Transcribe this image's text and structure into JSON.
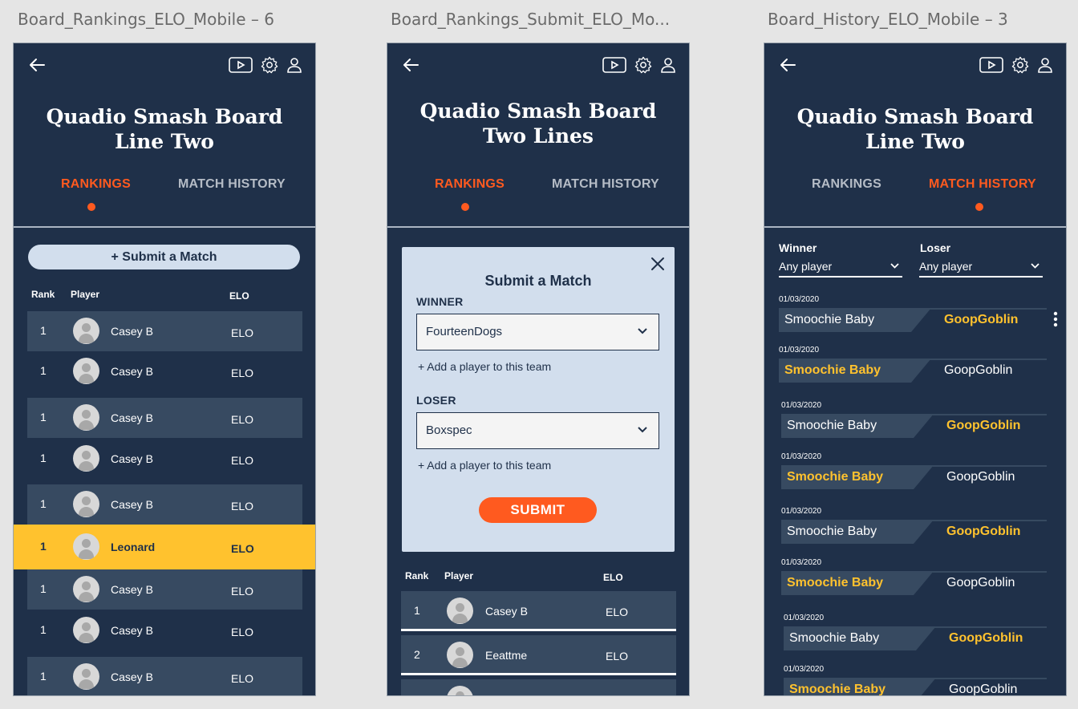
{
  "frames": {
    "rankings": {
      "label": "Board_Rankings_ELO_Mobile – 6",
      "title_line1": "Quadio Smash Board",
      "title_line2": "Line Two",
      "tab_rankings": "RANKINGS",
      "tab_history": "MATCH HISTORY",
      "submit_label": "+ Submit a Match",
      "col_rank": "Rank",
      "col_player": "Player",
      "col_elo": "ELO",
      "rows": [
        {
          "rank": "1",
          "name": "Casey B",
          "elo": "ELO"
        },
        {
          "rank": "1",
          "name": "Casey B",
          "elo": "ELO"
        },
        {
          "rank": "1",
          "name": "Casey B",
          "elo": "ELO"
        },
        {
          "rank": "1",
          "name": "Casey B",
          "elo": "ELO"
        },
        {
          "rank": "1",
          "name": "Casey B",
          "elo": "ELO"
        },
        {
          "rank": "1",
          "name": "Leonard",
          "elo": "ELO"
        },
        {
          "rank": "1",
          "name": "Casey B",
          "elo": "ELO"
        },
        {
          "rank": "1",
          "name": "Casey B",
          "elo": "ELO"
        },
        {
          "rank": "1",
          "name": "Casey B",
          "elo": "ELO"
        }
      ]
    },
    "submit": {
      "label": "Board_Rankings_Submit_ELO_Mo...",
      "title_line1": "Quadio Smash Board",
      "title_line2": "Two Lines",
      "tab_rankings": "RANKINGS",
      "tab_history": "MATCH HISTORY",
      "modal_title": "Submit a Match",
      "winner_label": "WINNER",
      "winner_value": "FourteenDogs",
      "add_player": "+ Add a player to this team",
      "loser_label": "LOSER",
      "loser_value": "Boxspec",
      "submit_button": "SUBMIT",
      "col_rank": "Rank",
      "col_player": "Player",
      "col_elo": "ELO",
      "rows": [
        {
          "rank": "1",
          "name": "Casey B",
          "elo": "ELO"
        },
        {
          "rank": "2",
          "name": "Eeattme",
          "elo": "ELO"
        }
      ]
    },
    "history": {
      "label": "Board_History_ELO_Mobile – 3",
      "title_line1": "Quadio Smash Board",
      "title_line2": "Line Two",
      "tab_rankings": "RANKINGS",
      "tab_history": "MATCH HISTORY",
      "winner_label": "Winner",
      "loser_label": "Loser",
      "winner_filter": "Any player",
      "loser_filter": "Any player",
      "matches": [
        {
          "date": "01/03/2020",
          "player1": "Smoochie Baby",
          "player2": "GoopGoblin",
          "winner": 2
        },
        {
          "date": "01/03/2020",
          "player1": "Smoochie Baby",
          "player2": "GoopGoblin",
          "winner": 1
        },
        {
          "date": "01/03/2020",
          "player1": "Smoochie Baby",
          "player2": "GoopGoblin",
          "winner": 2
        },
        {
          "date": "01/03/2020",
          "player1": "Smoochie Baby",
          "player2": "GoopGoblin",
          "winner": 1
        },
        {
          "date": "01/03/2020",
          "player1": "Smoochie Baby",
          "player2": "GoopGoblin",
          "winner": 2
        },
        {
          "date": "01/03/2020",
          "player1": "Smoochie Baby",
          "player2": "GoopGoblin",
          "winner": 1
        },
        {
          "date": "01/03/2020",
          "player1": "Smoochie Baby",
          "player2": "GoopGoblin",
          "winner": 2
        },
        {
          "date": "01/03/2020",
          "player1": "Smoochie Baby",
          "player2": "GoopGoblin",
          "winner": 1
        }
      ]
    }
  },
  "colors": {
    "background": "#1f3049",
    "accent": "#ff5a1f",
    "highlight": "#ffc22e",
    "row_alt": "#374a61",
    "panel": "#d2deed"
  },
  "icons": [
    "back-arrow-icon",
    "video-play-icon",
    "gear-icon",
    "user-icon",
    "close-icon",
    "chevron-down-icon",
    "kebab-menu-icon",
    "avatar-placeholder-icon"
  ]
}
